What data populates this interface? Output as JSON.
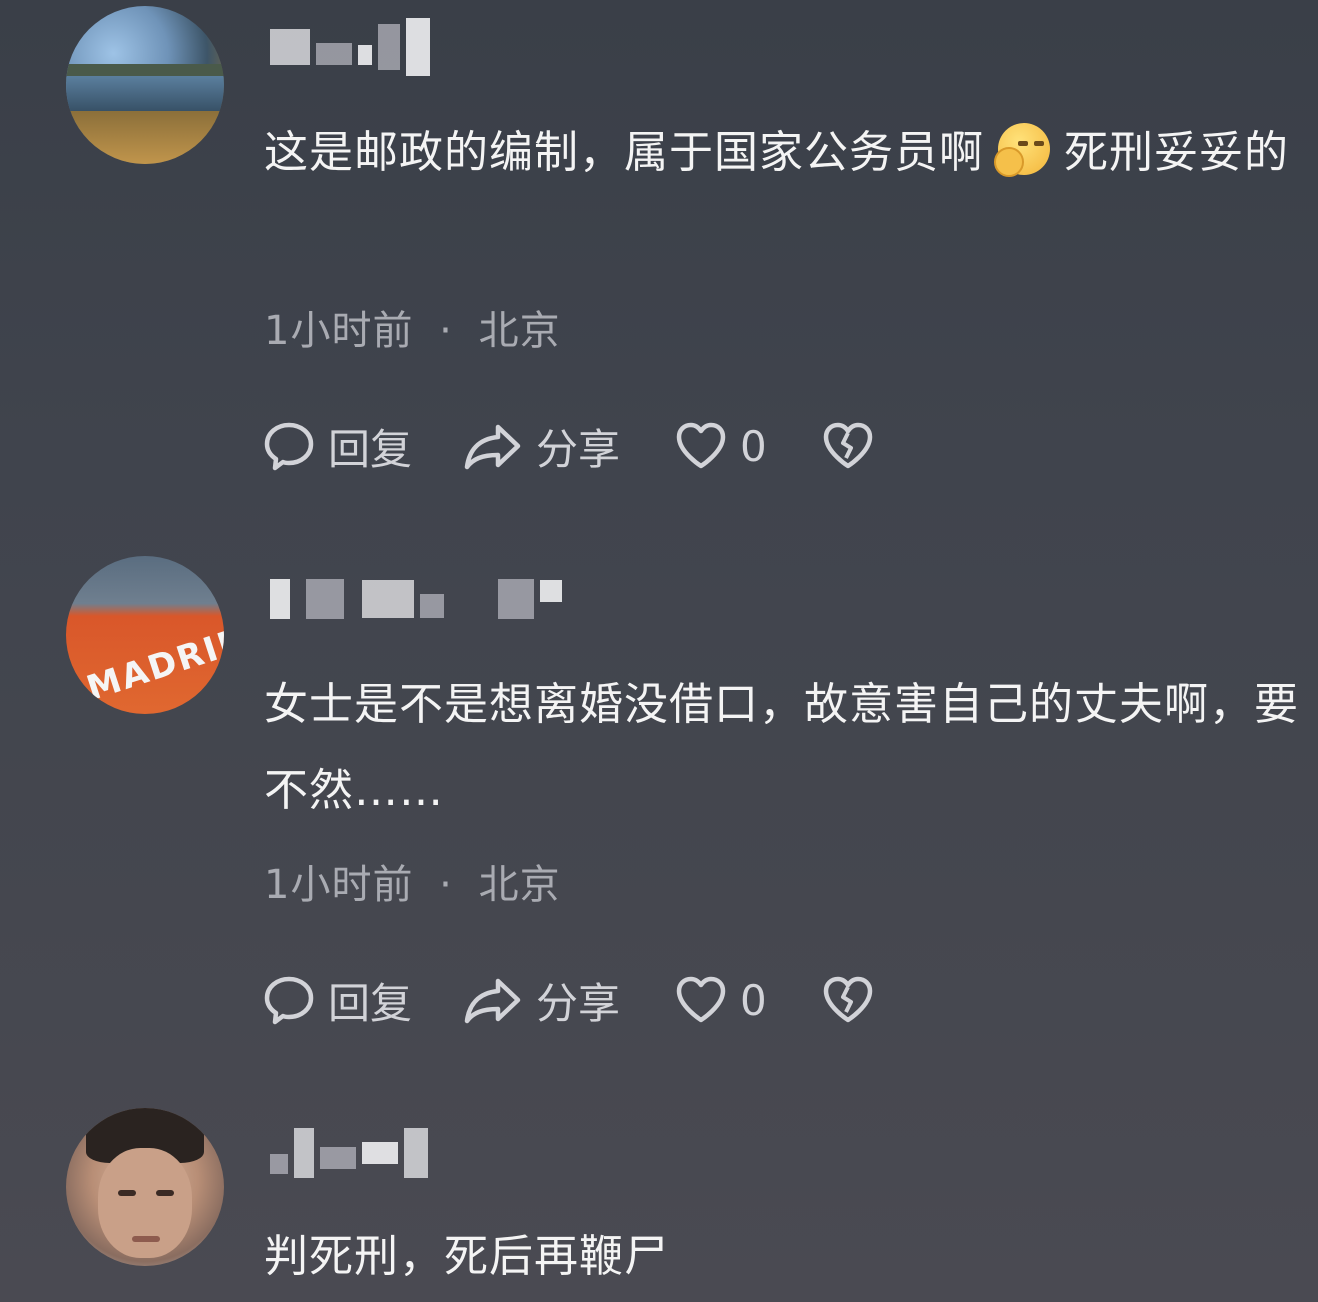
{
  "comments": [
    {
      "text_part1": "这是邮政的编制，属于国家公务员啊",
      "emoji": "thinking-face-emoji",
      "text_part2": "死刑妥妥的",
      "time": "1小时前",
      "location": "北京",
      "actions": {
        "reply": "回复",
        "share": "分享",
        "likes": "0"
      }
    },
    {
      "avatar_text": "MADRID",
      "text": "女士是不是想离婚没借口，故意害自己的丈夫啊，要不然……",
      "time": "1小时前",
      "location": "北京",
      "actions": {
        "reply": "回复",
        "share": "分享",
        "likes": "0"
      }
    },
    {
      "text": "判死刑，死后再鞭尸"
    }
  ],
  "separator": "·",
  "icons": [
    "comment-bubble-icon",
    "share-arrow-icon",
    "heart-icon",
    "broken-heart-icon"
  ],
  "colors": {
    "background": "#40444d",
    "text": "#f4f4f4",
    "meta": "#a9abb2",
    "icon": "#d2d3d8"
  }
}
